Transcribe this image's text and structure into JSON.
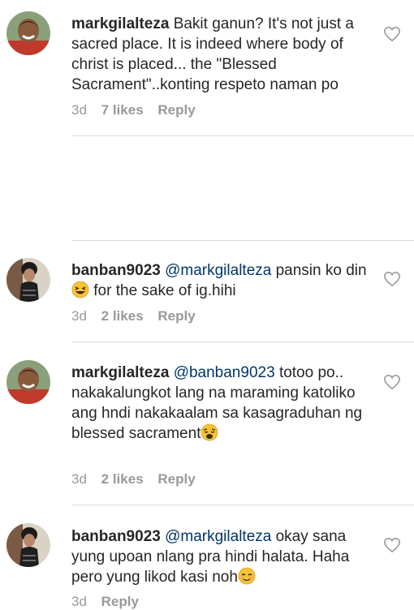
{
  "comments": [
    {
      "username": "markgilalteza",
      "mention": "",
      "body": "Bakit ganun? It's not just a sacred place. It is indeed where body of christ is placed... the \"Blessed Sacrament\"..konting respeto naman po",
      "emoji": "",
      "age": "3d",
      "likes": "7 likes",
      "reply": "Reply"
    },
    {
      "username": "banban9023",
      "mention": "@markgilalteza",
      "body": "pansin ko din",
      "tail": "for the sake of ig.hihi",
      "emoji": "laughing",
      "age": "3d",
      "likes": "2 likes",
      "reply": "Reply"
    },
    {
      "username": "markgilalteza",
      "mention": "@banban9023",
      "body": "totoo po.. nakakalungkot lang na maraming katoliko ang hndi nakakaalam sa kasagraduhan ng blessed sacrament",
      "emoji": "weary",
      "age": "3d",
      "likes": "2 likes",
      "reply": "Reply"
    },
    {
      "username": "banban9023",
      "mention": "@markgilalteza",
      "body": "okay sana yung upoan nlang pra hindi halata. Haha pero yung likod kasi noh",
      "emoji": "relieved",
      "age": "3d",
      "likes": "",
      "reply": "Reply"
    }
  ],
  "icons": {
    "like": "heart-outline-icon",
    "avatar": "profile-photo"
  },
  "colors": {
    "text": "#262626",
    "meta": "#999999",
    "mention": "#003569",
    "divider": "#dbdbdb"
  }
}
